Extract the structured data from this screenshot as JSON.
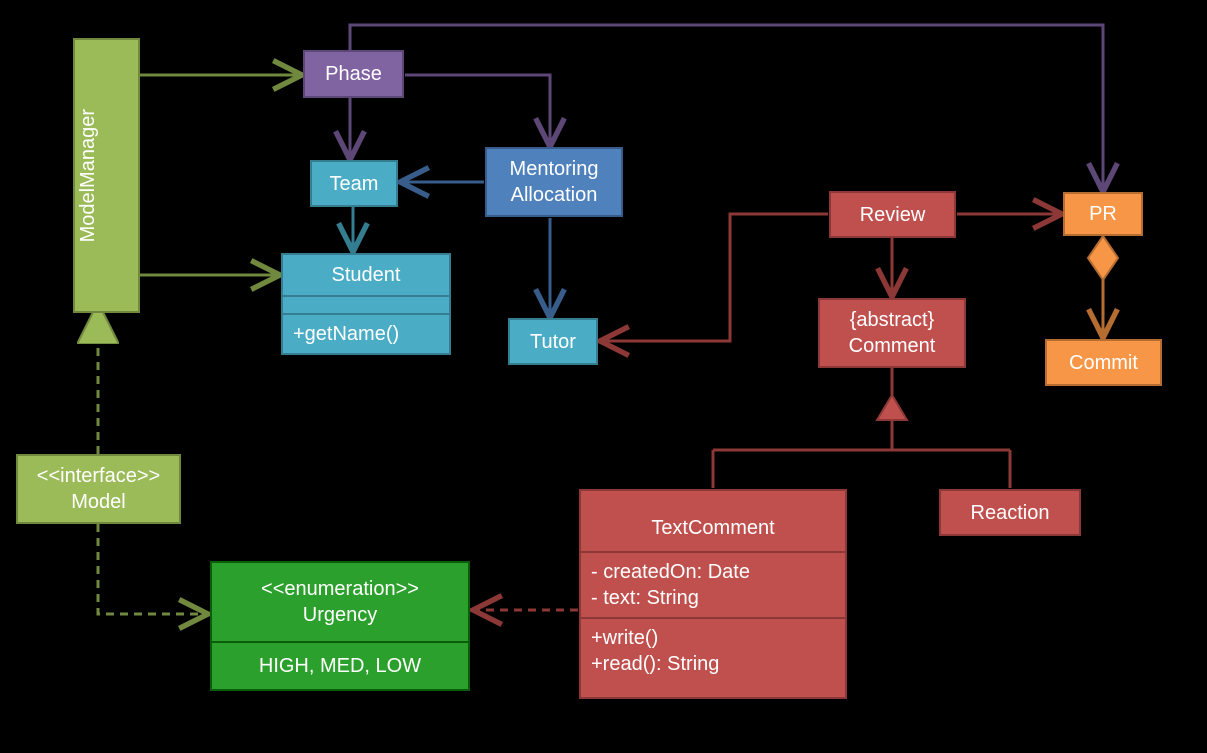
{
  "modelManager": {
    "label": "ModelManager"
  },
  "model": {
    "stereotype": "<<interface>>",
    "name": "Model"
  },
  "urgency": {
    "stereotype": "<<enumeration>>",
    "name": "Urgency",
    "values": "HIGH, MED, LOW"
  },
  "phase": {
    "label": "Phase"
  },
  "team": {
    "label": "Team"
  },
  "student": {
    "name": "Student",
    "method": "+getName()"
  },
  "mentoringAllocation": {
    "line1": "Mentoring",
    "line2": "Allocation"
  },
  "tutor": {
    "label": "Tutor"
  },
  "review": {
    "label": "Review"
  },
  "abstractComment": {
    "stereotype": "{abstract}",
    "name": "Comment"
  },
  "textComment": {
    "name": "TextComment",
    "attr1": "- createdOn: Date",
    "attr2": "- text: String",
    "method1": "+write()",
    "method2": "+read(): String"
  },
  "reaction": {
    "label": "Reaction"
  },
  "pr": {
    "label": "PR"
  },
  "commit": {
    "label": "Commit"
  },
  "colors": {
    "olive": "#71893f",
    "green": "#0a5e0a",
    "purple": "#5c4776",
    "teal": "#357d91",
    "blue": "#385d8a",
    "maroon": "#8c3836",
    "orange": "#b66d31"
  }
}
